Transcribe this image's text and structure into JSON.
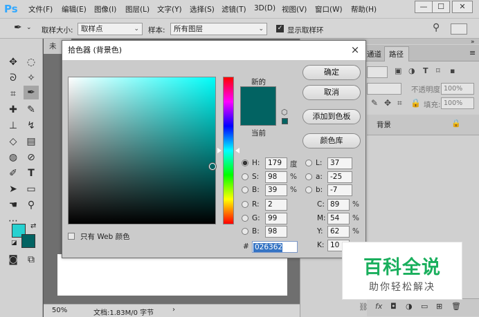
{
  "app": {
    "logo": "Ps"
  },
  "menu": [
    "文件(F)",
    "编辑(E)",
    "图像(I)",
    "图层(L)",
    "文字(Y)",
    "选择(S)",
    "滤镜(T)",
    "3D(D)",
    "视图(V)",
    "窗口(W)",
    "帮助(H)"
  ],
  "window_controls": {
    "minimize": "—",
    "maximize": "☐",
    "close": "✕"
  },
  "options_bar": {
    "sample_size_label": "取样大小:",
    "sample_size_value": "取样点",
    "sample_label": "样本:",
    "sample_value": "所有图层",
    "show_ring_label": "显示取样环",
    "show_ring_checked": true
  },
  "document": {
    "tab_label": "未",
    "zoom": "50%",
    "doc_info": "文档:1.83M/0 字节"
  },
  "panels": {
    "tabs": [
      "通道",
      "路径"
    ],
    "opacity_label": "不透明度:",
    "opacity_value": "100%",
    "fill_label": "填充:",
    "fill_value": "100%",
    "layer_name": "背景"
  },
  "dialog": {
    "title": "拾色器 (背景色)",
    "close_label": "×",
    "new_label": "新的",
    "current_label": "当前",
    "buttons": {
      "ok": "确定",
      "cancel": "取消",
      "add_swatch": "添加到色板",
      "color_library": "颜色库"
    },
    "web_only_label": "只有 Web 颜色",
    "hsb": {
      "h_label": "H:",
      "h_value": "179",
      "h_unit": "度",
      "s_label": "S:",
      "s_value": "98",
      "s_unit": "%",
      "b_label": "B:",
      "b_value": "39",
      "b_unit": "%"
    },
    "lab": {
      "l_label": "L:",
      "l_value": "37",
      "a_label": "a:",
      "a_value": "-25",
      "b_label": "b:",
      "b_value": "-7"
    },
    "rgb": {
      "r_label": "R:",
      "r_value": "2",
      "g_label": "G:",
      "g_value": "99",
      "b_label": "B:",
      "b_value": "98"
    },
    "cmyk": {
      "c_label": "C:",
      "c_value": "89",
      "m_label": "M:",
      "m_value": "54",
      "y_label": "Y:",
      "y_value": "62",
      "k_label": "K:",
      "k_value": "10",
      "unit": "%"
    },
    "hex_label": "#",
    "hex_value": "026362",
    "new_color": "#026362",
    "current_color": "#026362",
    "field_hue_color": "#00fdf9",
    "hue_slider_position": 0.5,
    "field_marker_saturation": 0.98,
    "field_marker_brightness": 0.39
  },
  "toolbar_colors": {
    "foreground": "#26d1d0",
    "background": "#026362"
  },
  "watermark": {
    "title": "百科全说",
    "subtitle": "助你轻松解决"
  }
}
